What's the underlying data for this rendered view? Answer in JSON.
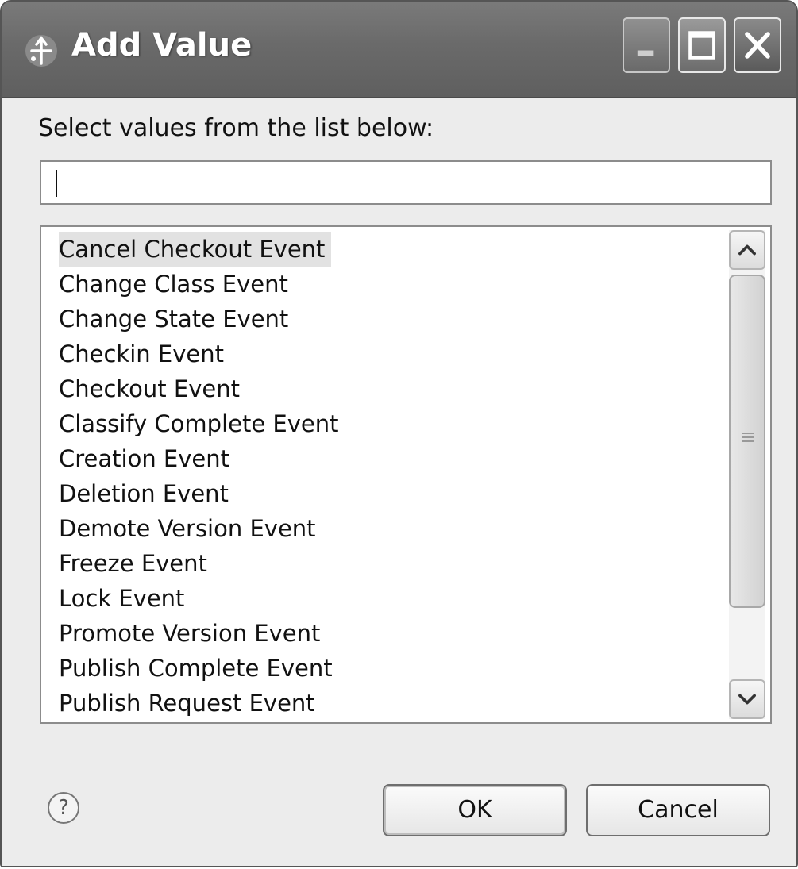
{
  "window": {
    "title": "Add Value",
    "icon": "app-icon",
    "controls": [
      "minimize-icon",
      "maximize-icon",
      "close-icon"
    ]
  },
  "dialog": {
    "prompt": "Select values from the list below:",
    "filter": {
      "value": "",
      "placeholder": ""
    },
    "list": {
      "selected_index": 0,
      "items": [
        "Cancel Checkout Event",
        "Change Class Event",
        "Change State Event",
        "Checkin Event",
        "Checkout Event",
        "Classify Complete Event",
        "Creation Event",
        "Deletion Event",
        "Demote Version Event",
        "Freeze Event",
        "Lock Event",
        "Promote Version Event",
        "Publish Complete Event",
        "Publish Request Event"
      ]
    },
    "help_icon": "help-icon",
    "help_glyph": "?",
    "buttons": {
      "ok": "OK",
      "cancel": "Cancel"
    }
  }
}
